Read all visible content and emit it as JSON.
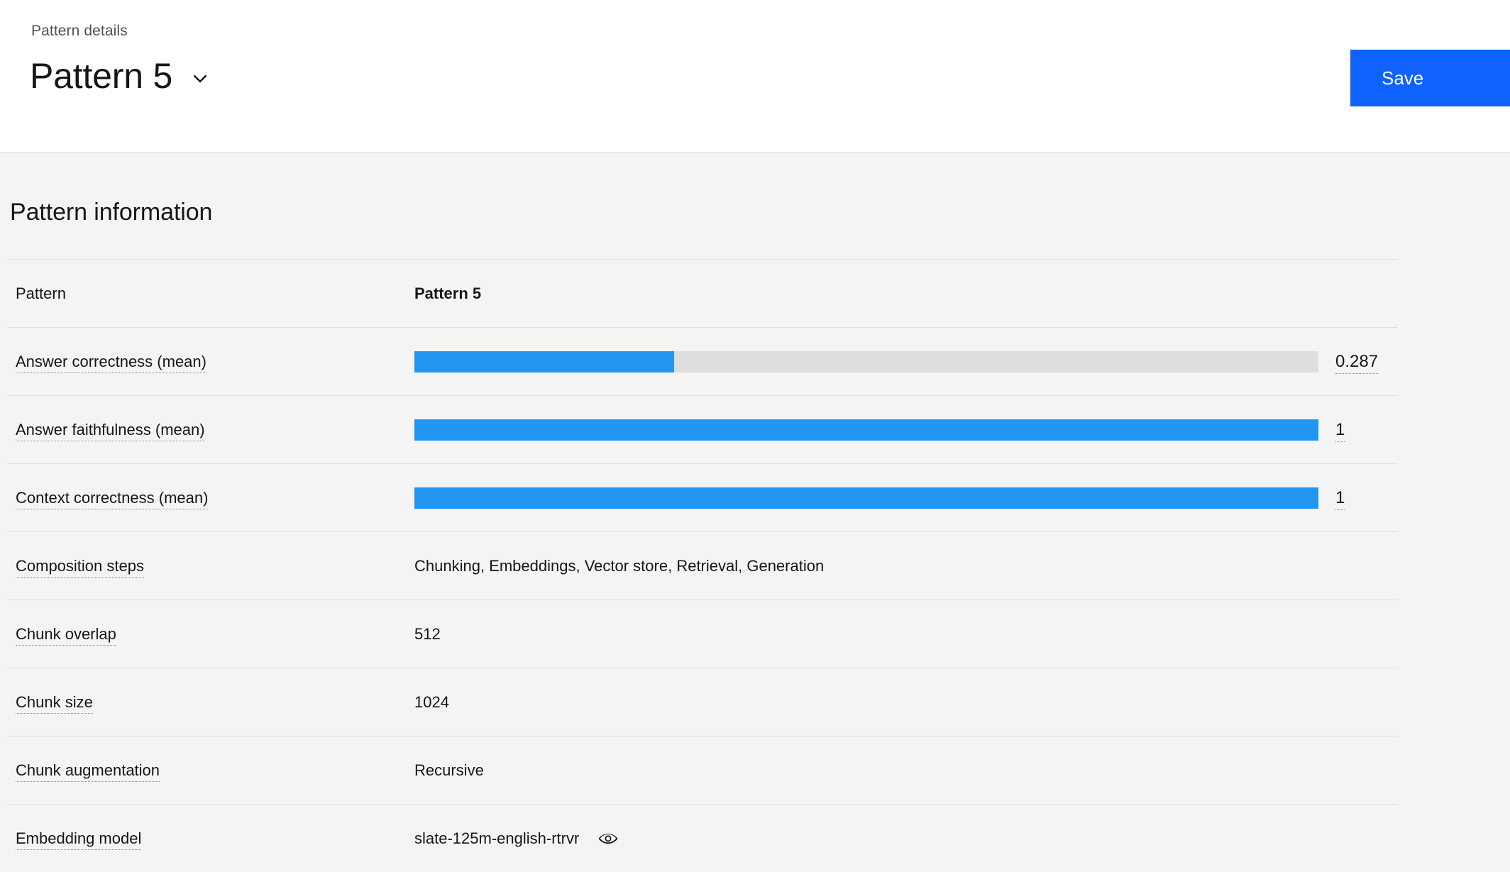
{
  "header": {
    "breadcrumb": "Pattern details",
    "title": "Pattern 5",
    "chevron_icon": "chevron-down-icon",
    "save_label": "Save",
    "accent_color": "#0f62fe"
  },
  "section": {
    "title": "Pattern information"
  },
  "colors": {
    "bar_fill": "#2196f3",
    "bar_track": "#dedede",
    "divider": "#e0e0e0",
    "page_background": "#f4f4f4",
    "header_background": "#ffffff"
  },
  "rows": [
    {
      "label": "Pattern",
      "type": "text",
      "value": "Pattern 5",
      "bold": true,
      "tooltip": false
    },
    {
      "label": "Answer correctness (mean)",
      "type": "metric",
      "value": "0.287",
      "fraction": 0.287,
      "tooltip": true
    },
    {
      "label": "Answer faithfulness (mean)",
      "type": "metric",
      "value": "1",
      "fraction": 1,
      "tooltip": true
    },
    {
      "label": "Context correctness (mean)",
      "type": "metric",
      "value": "1",
      "fraction": 1,
      "tooltip": true
    },
    {
      "label": "Composition steps",
      "type": "text",
      "value": "Chunking, Embeddings, Vector store, Retrieval, Generation",
      "bold": false,
      "tooltip": true
    },
    {
      "label": "Chunk overlap",
      "type": "text",
      "value": "512",
      "bold": false,
      "tooltip": true
    },
    {
      "label": "Chunk size",
      "type": "text",
      "value": "1024",
      "bold": false,
      "tooltip": true
    },
    {
      "label": "Chunk augmentation",
      "type": "text",
      "value": "Recursive",
      "bold": false,
      "tooltip": true
    },
    {
      "label": "Embedding model",
      "type": "text",
      "value": "slate-125m-english-rtrvr",
      "bold": false,
      "tooltip": true,
      "icon": "eye-icon"
    }
  ]
}
